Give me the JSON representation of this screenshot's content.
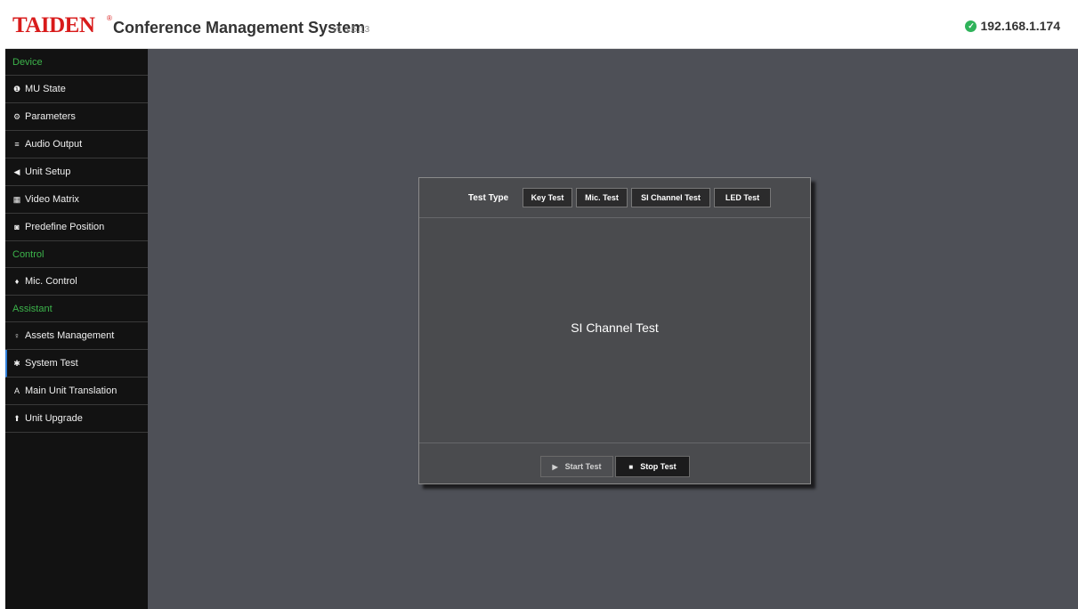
{
  "header": {
    "logo": "TAIDEN",
    "logo_reg": "®",
    "title": "Conference Management System",
    "version": "v1.1.5.13",
    "ip": "192.168.1.174"
  },
  "sidebar": {
    "sections": [
      {
        "label": "Device",
        "items": [
          {
            "label": "MU State",
            "icon": "info-circle-icon",
            "glyph": "❶"
          },
          {
            "label": "Parameters",
            "icon": "cogs-icon",
            "glyph": "⚙"
          },
          {
            "label": "Audio Output",
            "icon": "sliders-icon",
            "glyph": "≡"
          },
          {
            "label": "Unit Setup",
            "icon": "volume-icon",
            "glyph": "◀"
          },
          {
            "label": "Video Matrix",
            "icon": "grid-icon",
            "glyph": "▦"
          },
          {
            "label": "Predefine Position",
            "icon": "camera-icon",
            "glyph": "◙"
          }
        ]
      },
      {
        "label": "Control",
        "items": [
          {
            "label": "Mic. Control",
            "icon": "microphone-icon",
            "glyph": "♦"
          }
        ]
      },
      {
        "label": "Assistant",
        "items": [
          {
            "label": "Assets Management",
            "icon": "map-marker-icon",
            "glyph": "♀"
          },
          {
            "label": "System Test",
            "icon": "bug-icon",
            "glyph": "✱",
            "active": true
          },
          {
            "label": "Main Unit Translation",
            "icon": "font-icon",
            "glyph": "A"
          },
          {
            "label": "Unit Upgrade",
            "icon": "upload-icon",
            "glyph": "⬆"
          }
        ]
      }
    ]
  },
  "dialog": {
    "test_type_label": "Test Type",
    "tabs": [
      "Key Test",
      "Mic. Test",
      "SI Channel Test",
      "LED Test"
    ],
    "active_tab": "SI Channel Test",
    "content": "SI Channel Test",
    "start_label": "Start Test",
    "stop_label": "Stop Test"
  },
  "colors": {
    "brand_red": "#d81b1b",
    "section_green": "#3cb44b",
    "status_green": "#2fb35a",
    "active_blue": "#2f7ed8",
    "workspace": "#4e5057"
  }
}
